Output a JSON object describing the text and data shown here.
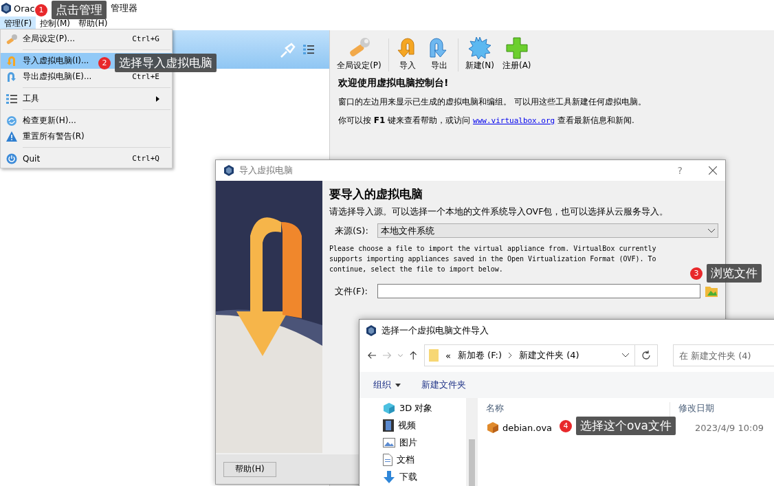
{
  "main_window": {
    "title_start": "Orac",
    "title_end": "管理器",
    "menu_bar": [
      {
        "label": "管理(F)",
        "selected": true
      },
      {
        "label": "控制(M)",
        "selected": false
      },
      {
        "label": "帮助(H)",
        "selected": false
      }
    ],
    "toolbar": [
      {
        "label": "全局设定(P)",
        "kind": "settings"
      },
      {
        "label": "导入",
        "kind": "import"
      },
      {
        "label": "导出",
        "kind": "export"
      },
      {
        "label": "新建(N)",
        "kind": "new"
      },
      {
        "label": "注册(A)",
        "kind": "add"
      }
    ],
    "welcome": {
      "heading": "欢迎使用虚拟电脑控制台!",
      "line_1": "窗口的左边用来显示已生成的虚拟电脑和编组。 可以用这些工具新建任何虚拟电脑。",
      "line_2_start": "你可以按 **F1** 键来查看帮助，或访问",
      "link": "www.virtualbox.org",
      "line_2_end": "查看最新信息和新闻."
    }
  },
  "menu": [
    {
      "kind": "item",
      "label": "全局设定(P)...",
      "shortcut": "Ctrl+G",
      "selected": false
    },
    {
      "kind": "separator"
    },
    {
      "kind": "item",
      "label": "导入虚拟电脑(I)...",
      "selected": true
    },
    {
      "kind": "item",
      "label": "导出虚拟电脑(E)...",
      "shortcut": "Ctrl+E",
      "selected": false
    },
    {
      "kind": "separator"
    },
    {
      "kind": "submenu",
      "label": "工具",
      "selected": false
    },
    {
      "kind": "separator"
    },
    {
      "kind": "item",
      "label": "检查更新(H)...",
      "selected": false
    },
    {
      "kind": "item",
      "label": "重置所有警告(R)",
      "selected": false
    },
    {
      "kind": "separator"
    },
    {
      "kind": "item",
      "label": "Quit",
      "shortcut": "Ctrl+Q",
      "selected": false
    }
  ],
  "import_dialog": {
    "title": "导入虚拟电脑",
    "help_glyph": "?",
    "heading": "要导入的虚拟电脑",
    "intro": "请选择导入源。可以选择一个本地的文件系统导入OVF包，也可以选择从云服务导入。",
    "source_label": "来源(S):",
    "source_value": "本地文件系统",
    "description": "Please choose a file to import the virtual appliance from. VirtualBox currently supports importing appliances saved in the Open Virtualization Format (OVF). To continue, select the file to import below.",
    "file_label": "文件(F):",
    "help_button": "帮助(H)"
  },
  "file_dialog": {
    "title": "选择一个虚拟电脑文件导入",
    "path_prefix": "«",
    "path": [
      "新加卷 (F:)",
      "新建文件夹 (4)"
    ],
    "search_placeholder": "在 新建文件夹 (4)",
    "toolbar": [
      "组织",
      "新建文件夹"
    ],
    "sidebar": [
      {
        "label": "3D 对象",
        "kind": "cube"
      },
      {
        "label": "视频",
        "kind": "video"
      },
      {
        "label": "图片",
        "kind": "picture"
      },
      {
        "label": "文档",
        "kind": "document"
      },
      {
        "label": "下载",
        "kind": "download"
      }
    ],
    "columns": [
      "名称",
      "修改日期"
    ],
    "rows": [
      {
        "name": "debian.ova",
        "date": "2023/4/9 10:09"
      }
    ]
  },
  "callouts": [
    {
      "number": "1",
      "text": "点击管理"
    },
    {
      "number": "2",
      "text": "选择导入虚拟电脑"
    },
    {
      "number": "3",
      "text": "浏览文件"
    },
    {
      "number": "4",
      "text": "选择这个ova文件"
    }
  ]
}
